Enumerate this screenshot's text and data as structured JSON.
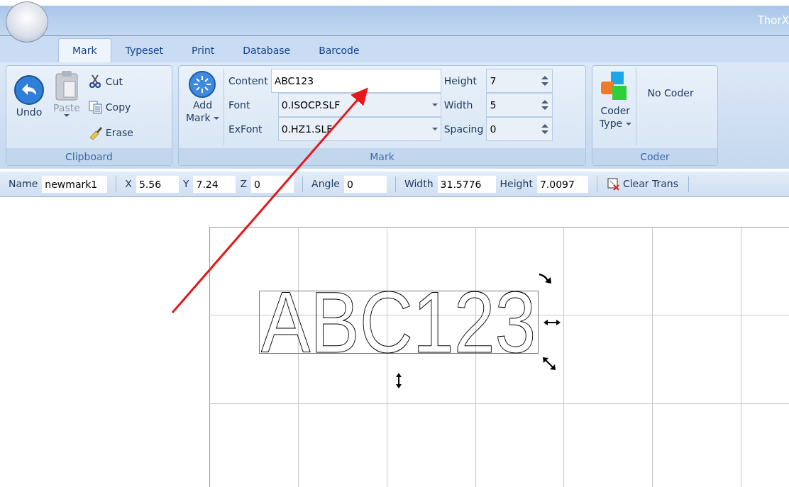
{
  "window": {
    "title": "ThorX"
  },
  "tabs": [
    {
      "label": "Mark",
      "selected": true
    },
    {
      "label": "Typeset",
      "selected": false
    },
    {
      "label": "Print",
      "selected": false
    },
    {
      "label": "Database",
      "selected": false
    },
    {
      "label": "Barcode",
      "selected": false
    }
  ],
  "clipboard": {
    "label": "Clipboard",
    "undo": {
      "label": "Undo",
      "disabled": false
    },
    "paste": {
      "label": "Paste",
      "disabled": true
    },
    "small_buttons": [
      {
        "kind": "cut",
        "label": "Cut"
      },
      {
        "kind": "copy",
        "label": "Copy"
      },
      {
        "kind": "erase",
        "label": "Erase"
      }
    ]
  },
  "mark": {
    "label": "Mark",
    "add_button": {
      "line1": "Add",
      "line2": "Mark"
    },
    "fields": [
      {
        "kind": "text",
        "label": "Content",
        "value": "ABC123"
      },
      {
        "kind": "select",
        "label": "Font",
        "value": "0.ISOCP.SLF"
      },
      {
        "kind": "select",
        "label": "ExFont",
        "value": "0.HZ1.SLF"
      }
    ],
    "spinners": [
      {
        "label": "Height",
        "value": "7"
      },
      {
        "label": "Width",
        "value": "5"
      },
      {
        "label": "Spacing",
        "value": "0"
      }
    ]
  },
  "coder": {
    "label": "Coder",
    "type_button": {
      "line1": "Coder",
      "line2": "Type"
    },
    "status": "No Coder"
  },
  "property_bar": {
    "groups": [
      [
        {
          "label": "Name",
          "value": "newmark1"
        }
      ],
      [
        {
          "label": "X",
          "value": "5.56"
        },
        {
          "label": "Y",
          "value": "7.24"
        },
        {
          "label": "Z",
          "value": "0"
        }
      ],
      [
        {
          "label": "Angle",
          "value": "0"
        }
      ],
      [
        {
          "label": "Width",
          "value": "31.5776"
        },
        {
          "label": "Height",
          "value": "7.0097"
        }
      ]
    ],
    "clear_button": "Clear Trans"
  },
  "canvas": {
    "mark_text": "ABC123"
  }
}
